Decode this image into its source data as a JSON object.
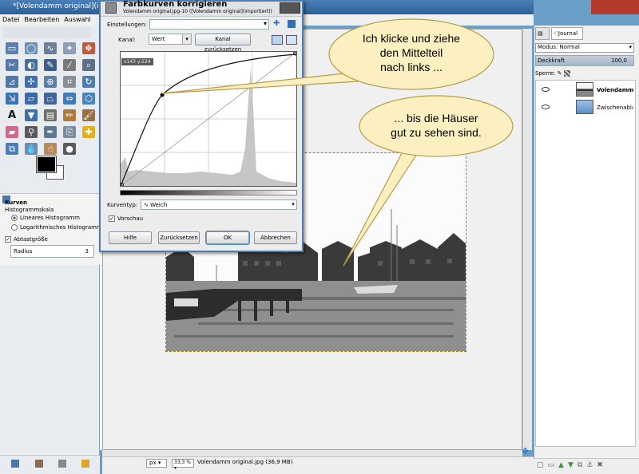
{
  "toolbox": {
    "title": "*[Volendamm original](importiert)",
    "menu": [
      "Datei",
      "Bearbeiten",
      "Auswahl"
    ],
    "options_title": "Kurven",
    "histogram_scale": "Histogrammskala",
    "linear_hist": "Lineares Histogramm",
    "log_hist": "Logarithmisches Histogramm",
    "sample_average": "Abtastgröße",
    "radius_label": "Radius",
    "radius_value": "3"
  },
  "dialog": {
    "title": "Farbkurven korrigieren",
    "subtitle": "Volendamm original.jpg-10 ([Volendamm original](importiert))",
    "presets_label": "Einstellungen:",
    "channel_label": "Kanal:",
    "channel_value": "Wert",
    "reset_channel": "Kanal zurücksetzen",
    "cursor_readout": "x143 y:224",
    "curve_type_label": "Kurventyp:",
    "curve_type_value": "Weich",
    "preview": "Vorschau",
    "buttons": {
      "help": "Hilfe",
      "reset": "Zurücksetzen",
      "ok": "OK",
      "cancel": "Abbrechen"
    }
  },
  "statusbar": {
    "unit": "px",
    "zoom": "33,3 %",
    "text": "Volendamm original.jpg (36,9 MB)"
  },
  "layers": {
    "tab_journal": "Journal",
    "mode_label": "Modus: Normal",
    "opacity_label": "Deckkraft",
    "opacity_value": "100,0",
    "lock_label": "Sperre:",
    "items": [
      {
        "name": "Volendamm orig"
      },
      {
        "name": "Zwischenablage"
      }
    ]
  },
  "callouts": {
    "one_line1": "Ich klicke und ziehe",
    "one_line2": "den Mittelteil",
    "one_line3": "nach links ...",
    "two_line1": "... bis die Häuser",
    "two_line2": "gut zu sehen sind."
  },
  "colors": {
    "title_bar": "#2d5f97",
    "callout_fill": "#fcf0c0",
    "callout_stroke": "#b59a4a"
  }
}
